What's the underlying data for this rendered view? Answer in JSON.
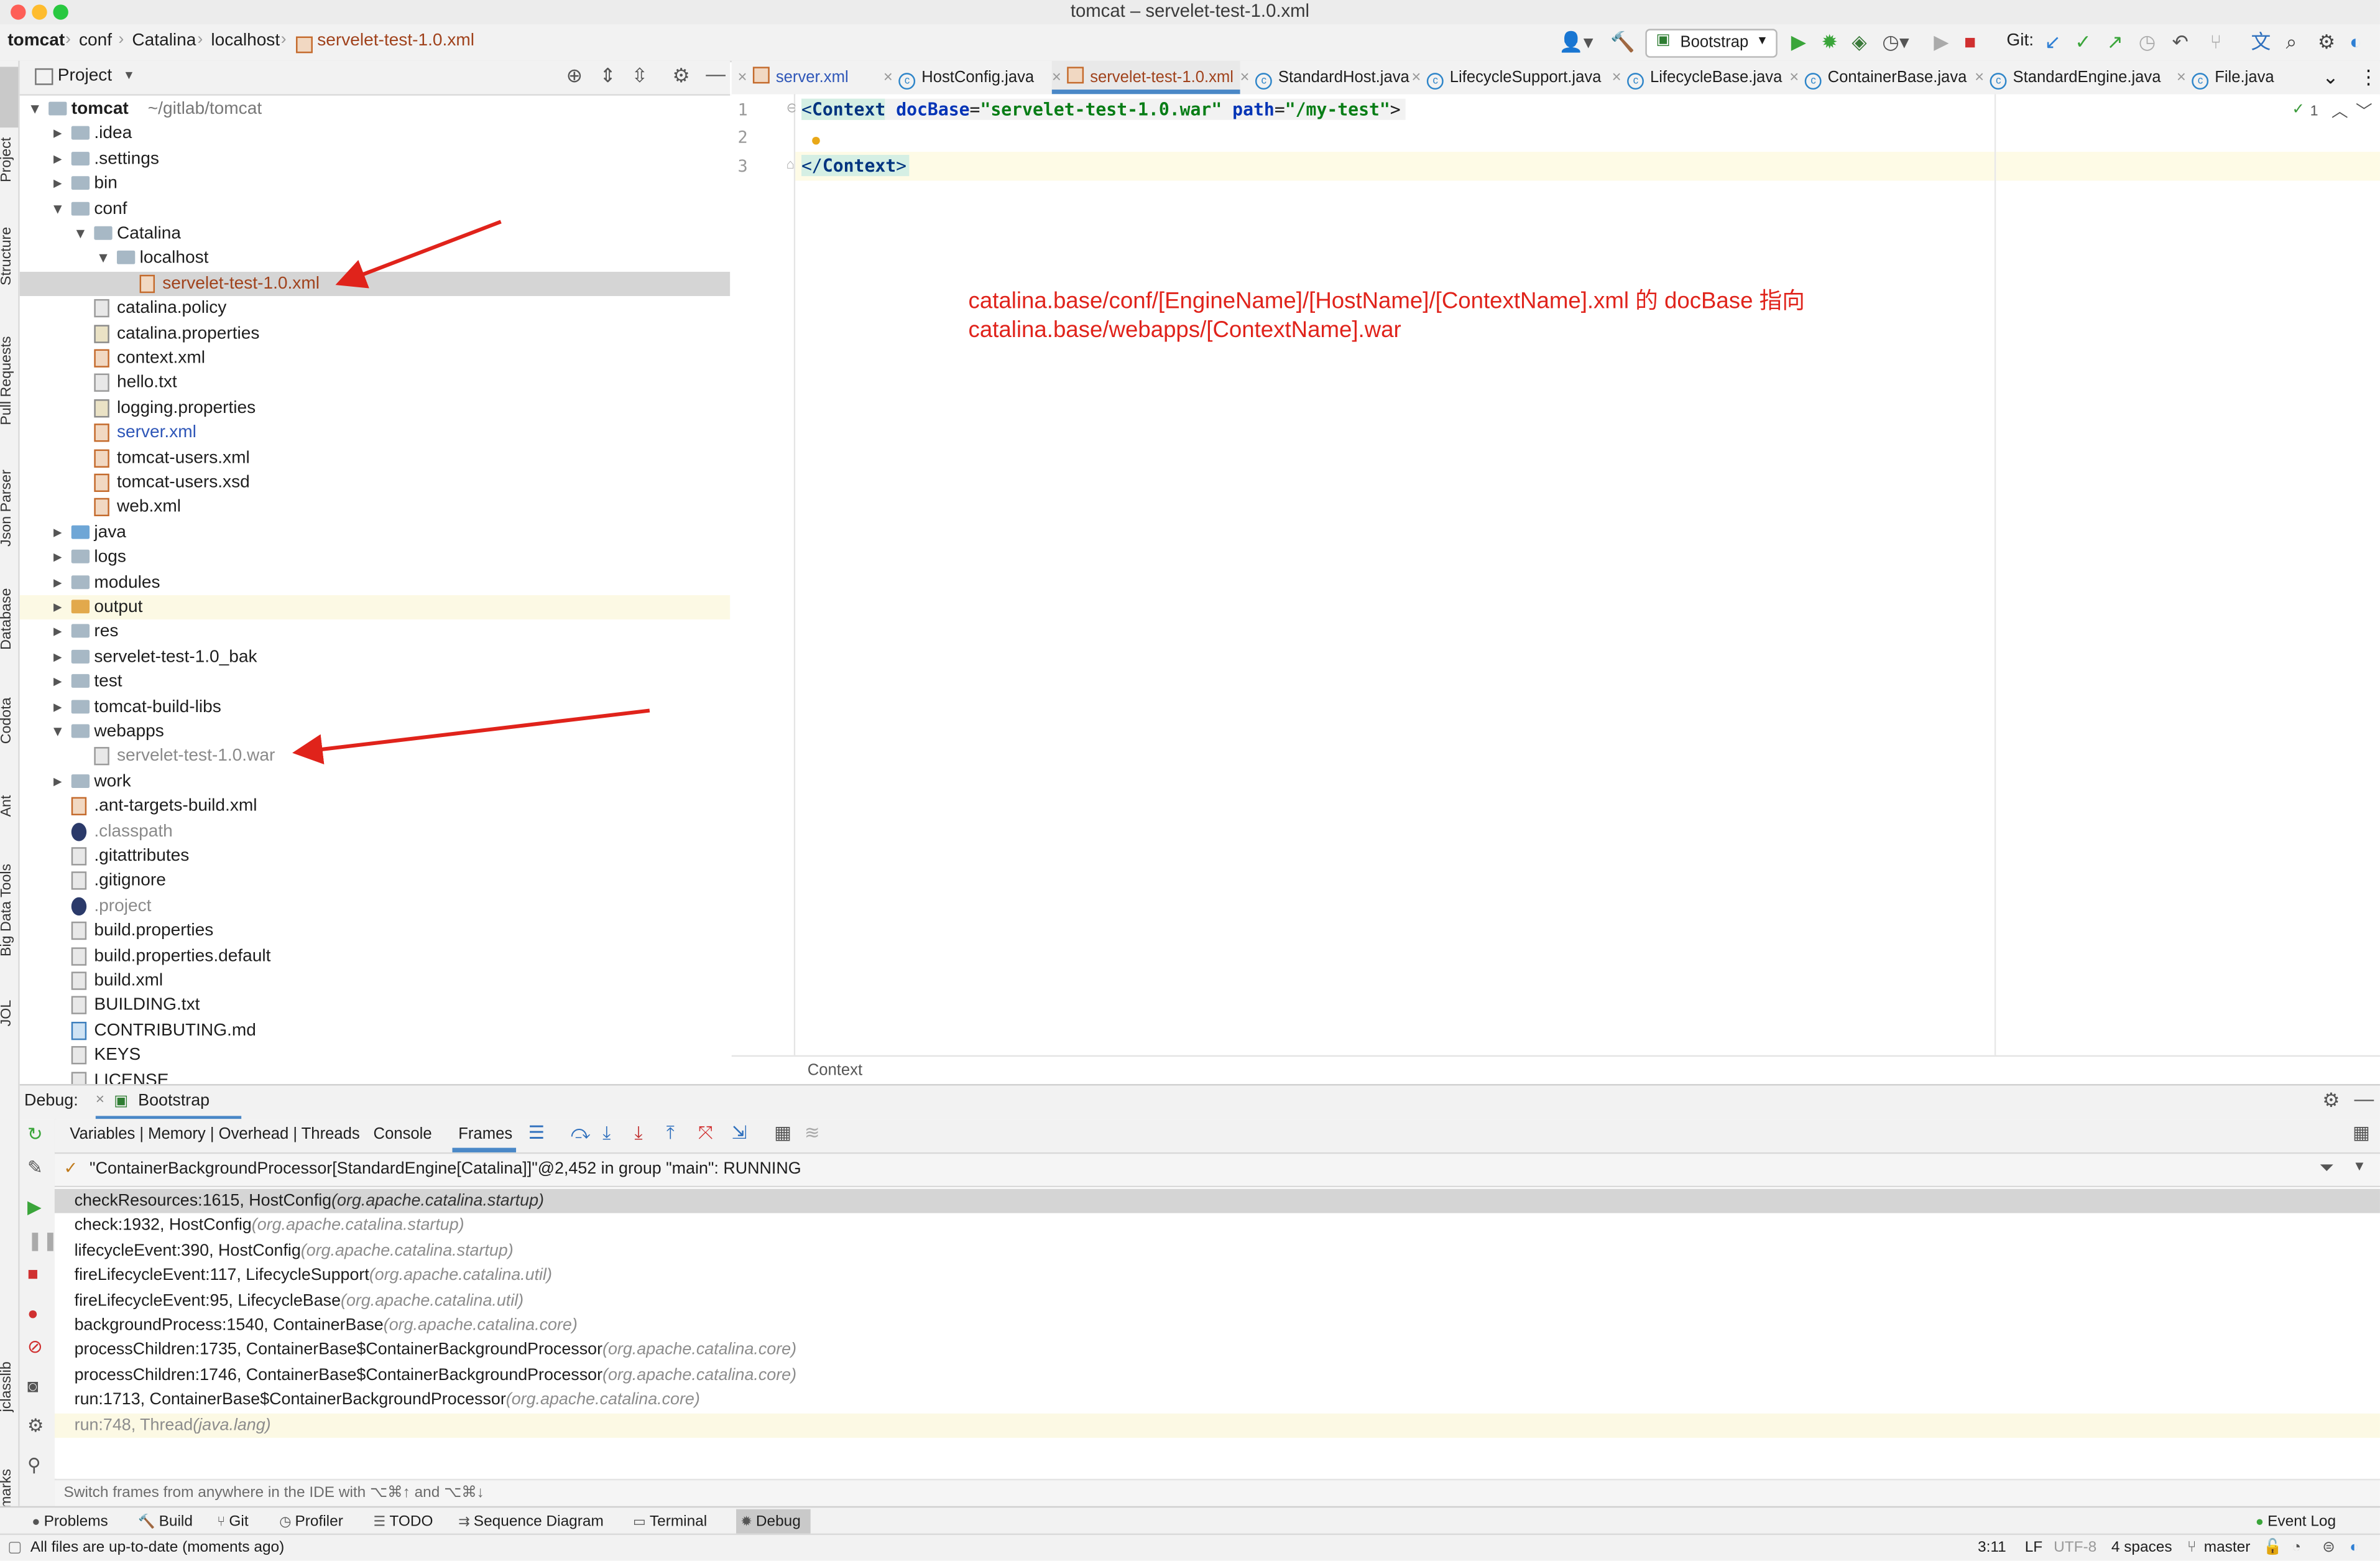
{
  "window": {
    "title": "tomcat – servelet-test-1.0.xml"
  },
  "breadcrumb": [
    "tomcat",
    "conf",
    "Catalina",
    "localhost",
    "servelet-test-1.0.xml"
  ],
  "toolbar": {
    "run_config": "Bootstrap",
    "git_label": "Git:"
  },
  "left_strip": [
    "Project",
    "Structure",
    "Pull Requests",
    "Json Parser",
    "Database",
    "Codota",
    "Ant",
    "Big Data Tools",
    "JOL",
    "jclasslib",
    "Bookmarks"
  ],
  "project": {
    "header": "Project",
    "tree": [
      {
        "name": "tomcat",
        "extra": "~/gitlab/tomcat",
        "indent": 0,
        "arrow": "open",
        "icon": "folder",
        "style": "bold"
      },
      {
        "name": ".idea",
        "indent": 1,
        "arrow": "closed",
        "icon": "folder"
      },
      {
        "name": ".settings",
        "indent": 1,
        "arrow": "closed",
        "icon": "folder"
      },
      {
        "name": "bin",
        "indent": 1,
        "arrow": "closed",
        "icon": "folder"
      },
      {
        "name": "conf",
        "indent": 1,
        "arrow": "open",
        "icon": "folder"
      },
      {
        "name": "Catalina",
        "indent": 2,
        "arrow": "open",
        "icon": "folder"
      },
      {
        "name": "localhost",
        "indent": 3,
        "arrow": "open",
        "icon": "folder"
      },
      {
        "name": "servelet-test-1.0.xml",
        "indent": 4,
        "icon": "xml",
        "style": "selected"
      },
      {
        "name": "catalina.policy",
        "indent": 2,
        "icon": "file"
      },
      {
        "name": "catalina.properties",
        "indent": 2,
        "icon": "prop"
      },
      {
        "name": "context.xml",
        "indent": 2,
        "icon": "xml"
      },
      {
        "name": "hello.txt",
        "indent": 2,
        "icon": "file"
      },
      {
        "name": "logging.properties",
        "indent": 2,
        "icon": "prop"
      },
      {
        "name": "server.xml",
        "indent": 2,
        "icon": "xml",
        "style": "modified"
      },
      {
        "name": "tomcat-users.xml",
        "indent": 2,
        "icon": "xml"
      },
      {
        "name": "tomcat-users.xsd",
        "indent": 2,
        "icon": "xml"
      },
      {
        "name": "web.xml",
        "indent": 2,
        "icon": "xml"
      },
      {
        "name": "java",
        "indent": 1,
        "arrow": "closed",
        "icon": "folder-blue"
      },
      {
        "name": "logs",
        "indent": 1,
        "arrow": "closed",
        "icon": "folder"
      },
      {
        "name": "modules",
        "indent": 1,
        "arrow": "closed",
        "icon": "folder"
      },
      {
        "name": "output",
        "indent": 1,
        "arrow": "closed",
        "icon": "folder-orange",
        "style": "excluded"
      },
      {
        "name": "res",
        "indent": 1,
        "arrow": "closed",
        "icon": "folder"
      },
      {
        "name": "servelet-test-1.0_bak",
        "indent": 1,
        "arrow": "closed",
        "icon": "folder"
      },
      {
        "name": "test",
        "indent": 1,
        "arrow": "closed",
        "icon": "folder"
      },
      {
        "name": "tomcat-build-libs",
        "indent": 1,
        "arrow": "closed",
        "icon": "folder"
      },
      {
        "name": "webapps",
        "indent": 1,
        "arrow": "open",
        "icon": "folder"
      },
      {
        "name": "servelet-test-1.0.war",
        "indent": 2,
        "icon": "file",
        "style": "ignored"
      },
      {
        "name": "work",
        "indent": 1,
        "arrow": "closed",
        "icon": "folder"
      },
      {
        "name": ".ant-targets-build.xml",
        "indent": 1,
        "icon": "xml"
      },
      {
        "name": ".classpath",
        "indent": 1,
        "icon": "eclipse",
        "style": "ignored"
      },
      {
        "name": ".gitattributes",
        "indent": 1,
        "icon": "file"
      },
      {
        "name": ".gitignore",
        "indent": 1,
        "icon": "file"
      },
      {
        "name": ".project",
        "indent": 1,
        "icon": "eclipse",
        "style": "ignored"
      },
      {
        "name": "build.properties",
        "indent": 1,
        "icon": "file"
      },
      {
        "name": "build.properties.default",
        "indent": 1,
        "icon": "file"
      },
      {
        "name": "build.xml",
        "indent": 1,
        "icon": "file"
      },
      {
        "name": "BUILDING.txt",
        "indent": 1,
        "icon": "file"
      },
      {
        "name": "CONTRIBUTING.md",
        "indent": 1,
        "icon": "md"
      },
      {
        "name": "KEYS",
        "indent": 1,
        "icon": "file"
      },
      {
        "name": "LICENSE",
        "indent": 1,
        "icon": "file"
      }
    ]
  },
  "editor": {
    "tabs": [
      {
        "label": "server.xml",
        "kind": "xml"
      },
      {
        "label": "HostConfig.java",
        "kind": "class"
      },
      {
        "label": "servelet-test-1.0.xml",
        "kind": "xml",
        "active": true
      },
      {
        "label": "StandardHost.java",
        "kind": "class"
      },
      {
        "label": "LifecycleSupport.java",
        "kind": "class"
      },
      {
        "label": "LifecycleBase.java",
        "kind": "class"
      },
      {
        "label": "ContainerBase.java",
        "kind": "class"
      },
      {
        "label": "StandardEngine.java",
        "kind": "class"
      },
      {
        "label": "File.java",
        "kind": "class"
      }
    ],
    "line_numbers": [
      "1",
      "2",
      "3"
    ],
    "code": {
      "open_tag": "Context",
      "attr1_name": "docBase",
      "attr1_value": "\"servelet-test-1.0.war\"",
      "attr2_name": "path",
      "attr2_value": "\"/my-test\"",
      "close_tag": "Context"
    },
    "inspection_count": "1",
    "annotation_line1": "catalina.base/conf/[EngineName]/[HostName]/[ContextName].xml 的 docBase 指向",
    "annotation_line2": "catalina.base/webapps/[ContextName].war",
    "annotation_color": "#e0231b",
    "breadcrumb_footer": "Context"
  },
  "debug": {
    "label": "Debug:",
    "session": "Bootstrap",
    "tabs": [
      "Variables | Memory | Overhead | Threads",
      "Console",
      "Frames"
    ],
    "thread": "\"ContainerBackgroundProcessor[StandardEngine[Catalina]]\"@2,452 in group \"main\": RUNNING",
    "frames": [
      {
        "method": "checkResources:1615, HostConfig",
        "pkg": "(org.apache.catalina.startup)"
      },
      {
        "method": "check:1932, HostConfig",
        "pkg": "(org.apache.catalina.startup)"
      },
      {
        "method": "lifecycleEvent:390, HostConfig",
        "pkg": "(org.apache.catalina.startup)"
      },
      {
        "method": "fireLifecycleEvent:117, LifecycleSupport",
        "pkg": "(org.apache.catalina.util)"
      },
      {
        "method": "fireLifecycleEvent:95, LifecycleBase",
        "pkg": "(org.apache.catalina.util)"
      },
      {
        "method": "backgroundProcess:1540, ContainerBase",
        "pkg": "(org.apache.catalina.core)"
      },
      {
        "method": "processChildren:1735, ContainerBase$ContainerBackgroundProcessor",
        "pkg": "(org.apache.catalina.core)"
      },
      {
        "method": "processChildren:1746, ContainerBase$ContainerBackgroundProcessor",
        "pkg": "(org.apache.catalina.core)"
      },
      {
        "method": "run:1713, ContainerBase$ContainerBackgroundProcessor",
        "pkg": "(org.apache.catalina.core)"
      },
      {
        "method": "run:748, Thread",
        "pkg": "(java.lang)"
      }
    ],
    "hint": "Switch frames from anywhere in the IDE with ⌥⌘↑ and ⌥⌘↓"
  },
  "bottom_tools": [
    "Problems",
    "Build",
    "Git",
    "Profiler",
    "TODO",
    "Sequence Diagram",
    "Terminal",
    "Debug"
  ],
  "event_log": "Event Log",
  "status": {
    "message": "All files are up-to-date (moments ago)",
    "position": "3:11",
    "line_sep": "LF",
    "encoding": "UTF-8",
    "indent": "4 spaces",
    "branch": "master"
  }
}
